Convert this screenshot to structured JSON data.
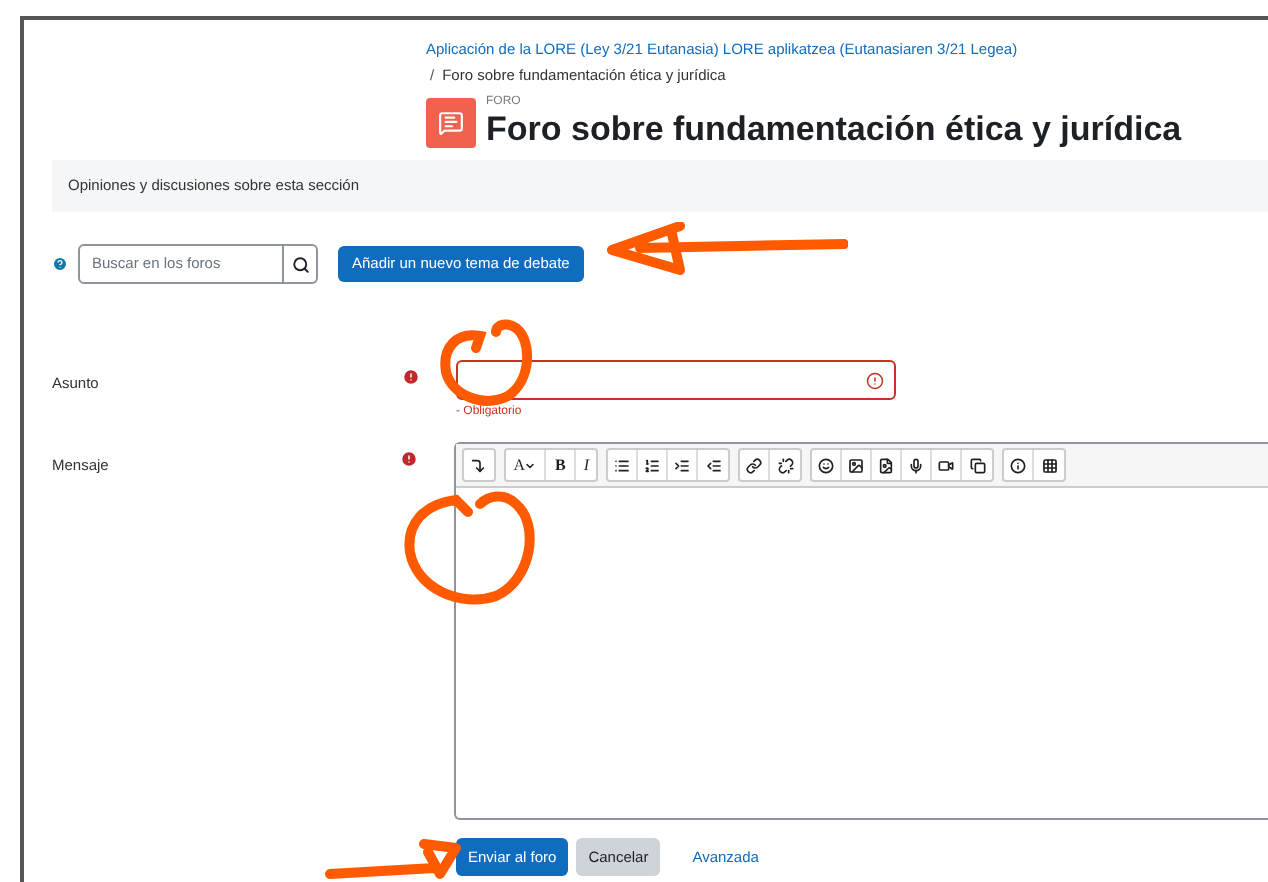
{
  "breadcrumb": [
    {
      "label": "Aplicación de la LORE (Ley 3/21 Eutanasia) LORE aplikatzea (Eutanasiaren 3/21 Legea)",
      "link": true
    },
    {
      "separator": "/",
      "label": "Foro sobre fundamentación ética y jurídica",
      "link": false
    }
  ],
  "header": {
    "kicker": "FORO",
    "title": "Foro sobre fundamentación ética y jurídica"
  },
  "description": "Opiniones y discusiones sobre esta sección",
  "search": {
    "placeholder": "Buscar en los foros"
  },
  "add_button": "Añadir un nuevo tema de debate",
  "fields": [
    {
      "label": "Asunto",
      "required": true,
      "error": "- Obligatorio"
    },
    {
      "label": "Mensaje",
      "required": true
    }
  ],
  "toolbar": [
    [
      {
        "kind": "icon"
      }
    ],
    [
      {
        "kind": "menu",
        "label": "A"
      },
      {
        "kind": "bold",
        "label": "B"
      },
      {
        "kind": "italic",
        "label": "I"
      }
    ],
    [
      {
        "kind": "icon"
      },
      {
        "kind": "icon"
      },
      {
        "kind": "icon"
      },
      {
        "kind": "icon"
      }
    ],
    [
      {
        "kind": "icon"
      },
      {
        "kind": "icon"
      }
    ],
    [
      {
        "kind": "icon"
      },
      {
        "kind": "icon"
      },
      {
        "kind": "icon"
      },
      {
        "kind": "icon"
      },
      {
        "kind": "icon"
      },
      {
        "kind": "icon"
      }
    ],
    [
      {
        "kind": "icon"
      },
      {
        "kind": "icon"
      }
    ]
  ],
  "buttons": [
    {
      "label": "Enviar al foro",
      "kind": "primary"
    },
    {
      "label": "Cancelar",
      "kind": "secondary"
    },
    {
      "label": "Avanzada",
      "kind": "link"
    }
  ]
}
